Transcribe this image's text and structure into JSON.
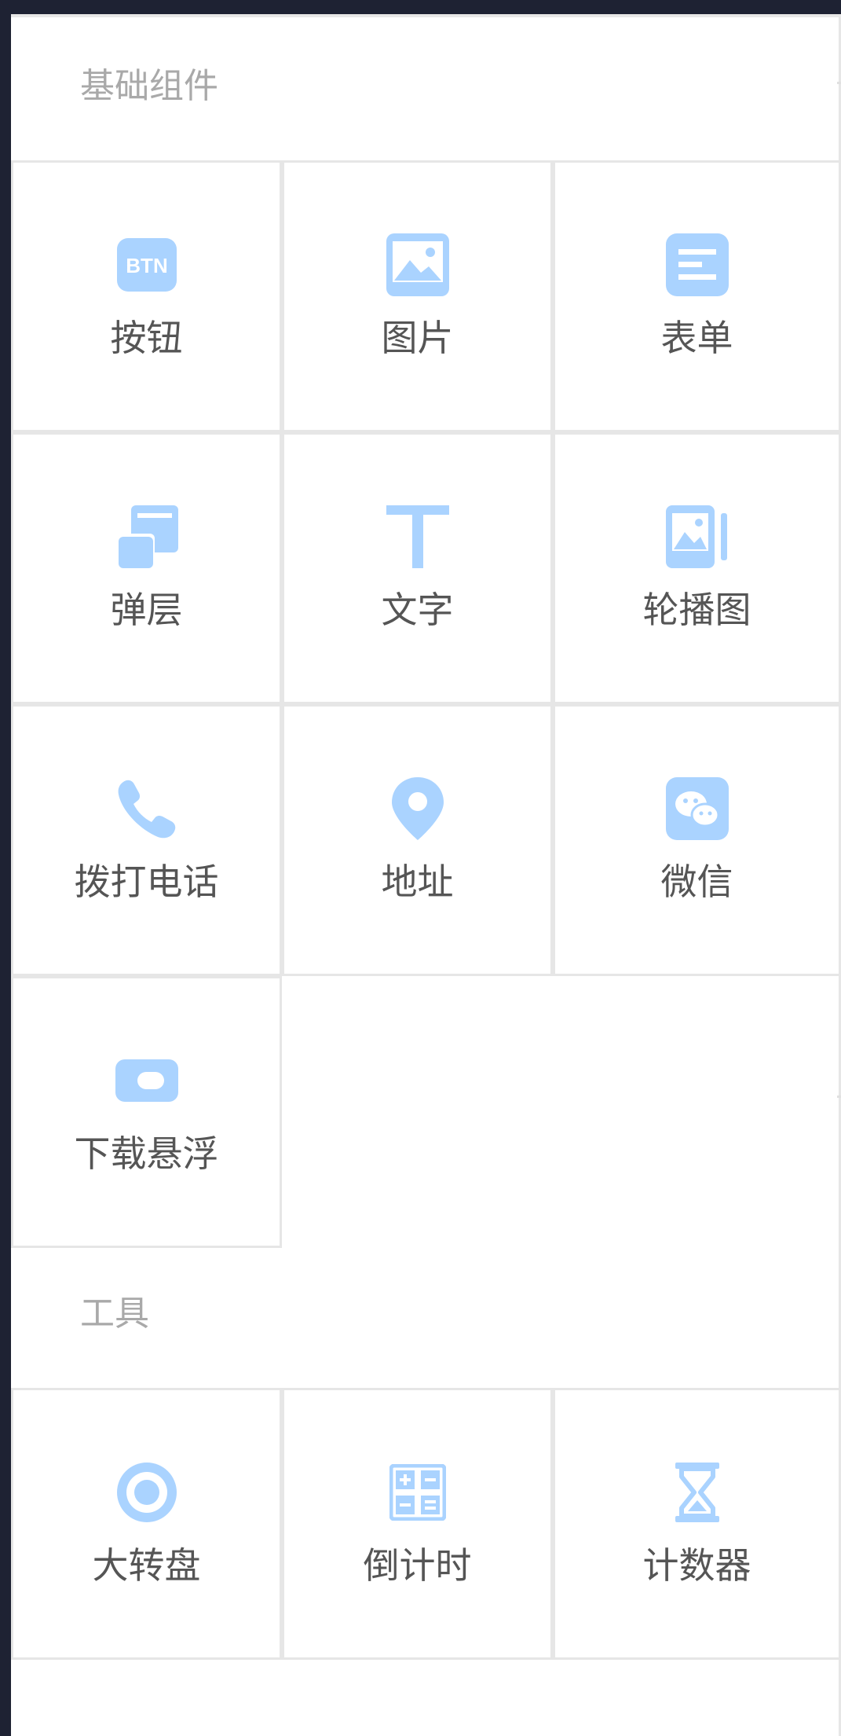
{
  "colors": {
    "icon": "#aad3ff",
    "label": "#555555",
    "header": "#a9a9a9",
    "border": "#e6e6e6",
    "frame": "#1e2233"
  },
  "sections": {
    "basic": {
      "title": "基础组件",
      "items": [
        {
          "label": "按钮",
          "icon": "btn-icon"
        },
        {
          "label": "图片",
          "icon": "image-icon"
        },
        {
          "label": "表单",
          "icon": "form-icon"
        },
        {
          "label": "弹层",
          "icon": "popup-layer-icon"
        },
        {
          "label": "文字",
          "icon": "text-icon"
        },
        {
          "label": "轮播图",
          "icon": "carousel-icon"
        },
        {
          "label": "拨打电话",
          "icon": "phone-icon"
        },
        {
          "label": "地址",
          "icon": "location-pin-icon"
        },
        {
          "label": "微信",
          "icon": "wechat-icon"
        },
        {
          "label": "下载悬浮",
          "icon": "download-float-icon"
        }
      ]
    },
    "tools": {
      "title": "工具",
      "items": [
        {
          "label": "大转盘",
          "icon": "wheel-icon"
        },
        {
          "label": "倒计时",
          "icon": "countdown-icon"
        },
        {
          "label": "计数器",
          "icon": "hourglass-icon"
        }
      ]
    }
  }
}
